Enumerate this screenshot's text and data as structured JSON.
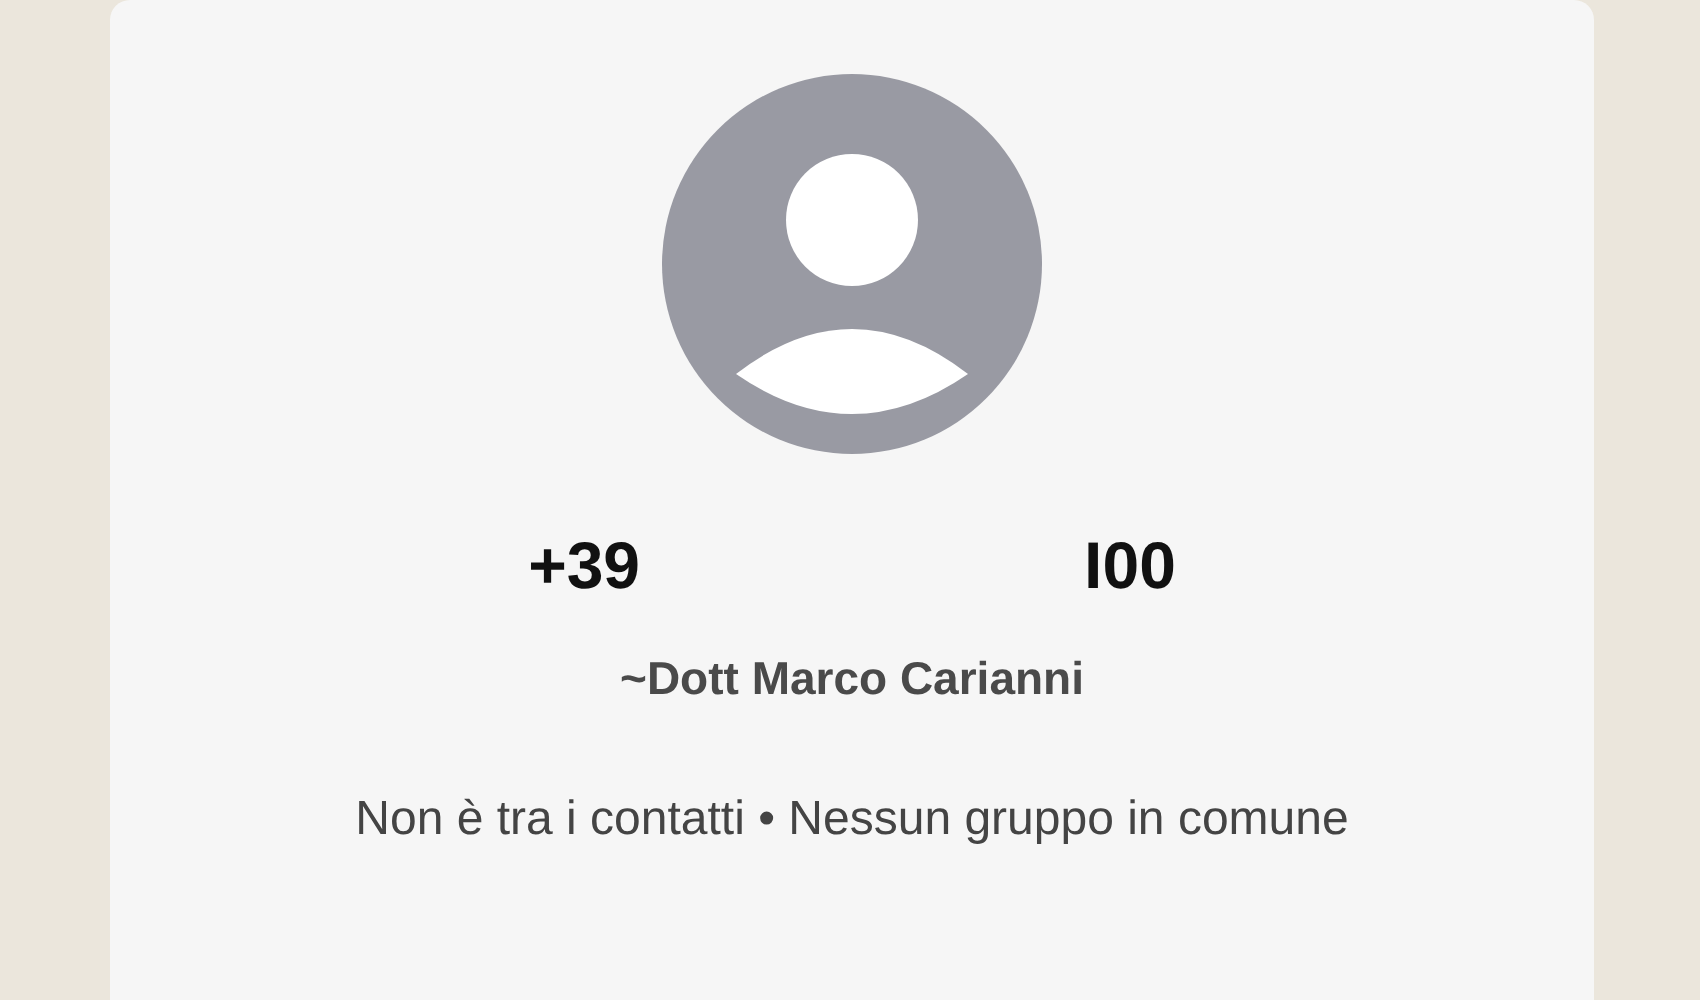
{
  "profile": {
    "phone_parts": [
      "+39",
      "I00"
    ],
    "name": "~Dott Marco Carianni",
    "info": "Non è tra i contatti • Nessun gruppo in comune"
  }
}
